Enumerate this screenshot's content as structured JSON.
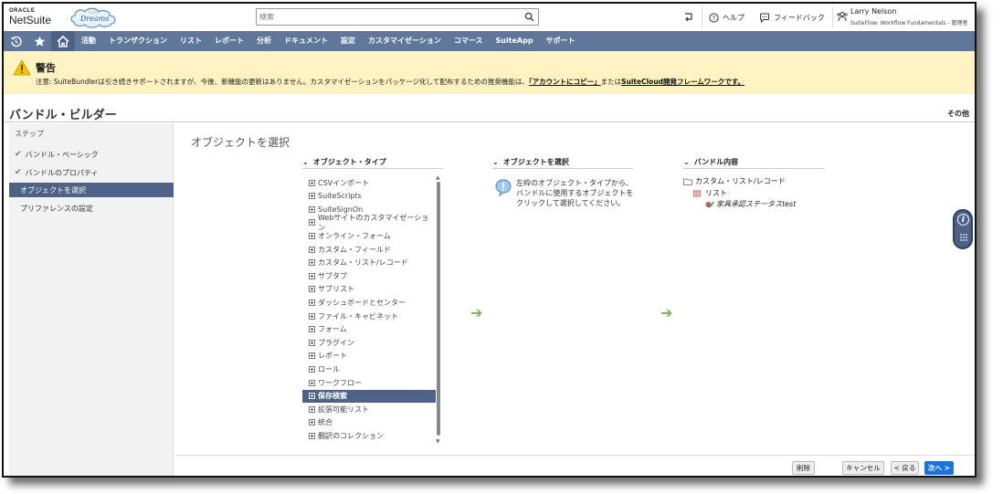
{
  "header": {
    "logo_oracle": "ORACLE",
    "logo_netsuite": "NetSuite",
    "logo_dreams_top": "SUITE",
    "logo_dreams": "Dreams",
    "search_placeholder": "検索",
    "help": "ヘルプ",
    "feedback": "フィードバック",
    "user_name": "Larry Nelson",
    "user_role": "SuiteFlow: Workflow Fundamentals - 管理者"
  },
  "nav": {
    "items": [
      "活動",
      "トランザクション",
      "リスト",
      "レポート",
      "分析",
      "ドキュメント",
      "設定",
      "カスタマイゼーション",
      "コマース",
      "SuiteApp",
      "サポート"
    ]
  },
  "warning": {
    "title": "警告",
    "text_prefix": "注意: SuiteBundlerは引き続きサポートされますが、今後、新機能の更新はありません。カスタマイゼーションをパッケージ化して配布するための推奨機能は、",
    "link1": "「アカウントにコピー」",
    "text_mid": "または",
    "link2": "SuiteCloud開発フレームワークです。"
  },
  "page": {
    "title": "バンドル・ビルダー",
    "more": "その他"
  },
  "steps": {
    "heading": "ステップ",
    "items": [
      {
        "label": "バンドル・ベーシック",
        "done": true
      },
      {
        "label": "バンドルのプロパティ",
        "done": true
      },
      {
        "label": "オブジェクトを選択",
        "active": true
      },
      {
        "label": "プリファレンスの設定"
      }
    ]
  },
  "main": {
    "title": "オブジェクトを選択",
    "col_object_type": "オブジェクト・タイプ",
    "col_select_object": "オブジェクトを選択",
    "col_bundle_contents": "バンドル内容",
    "object_types": [
      "CSVインポート",
      "SuiteScripts",
      "SuiteSignOn",
      "Webサイトのカスタマイゼーション",
      "オンライン・フォーム",
      "カスタム・フィールド",
      "カスタム・リスト/レコード",
      "サブタブ",
      "サブリスト",
      "ダッシュボードとセンター",
      "ファイル・キャビネット",
      "フォーム",
      "プラグイン",
      "レポート",
      "ロール",
      "ワークフロー",
      "保存検索",
      "拡張可能リスト",
      "統合",
      "翻訳のコレクション"
    ],
    "selected_object_type": "保存検索",
    "info_text": "左枠のオブジェクト・タイプから、バンドルに使用するオブジェクトをクリックして選択してください。",
    "tree": {
      "root": "カスタム・リスト/レコード",
      "child": "リスト",
      "leaf": "家具承認ステータスtest"
    },
    "buttons": {
      "delete": "削除",
      "cancel": "キャンセル",
      "back": "< 戻る",
      "next": "次へ >"
    }
  }
}
